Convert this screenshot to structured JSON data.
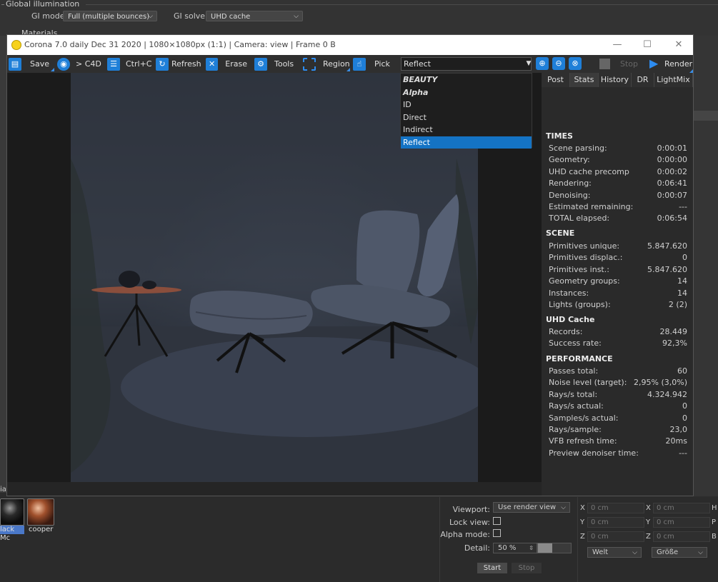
{
  "background": {
    "gi_section_title": "Global illumination",
    "gi_mode_label": "GI mode",
    "gi_mode_value": "Full (multiple bounces)",
    "gi_solver_label": "GI solver",
    "gi_solver_value": "UHD cache",
    "materials_title": "Materials",
    "media_label": "ia"
  },
  "materials": [
    {
      "label": "lack Mc"
    },
    {
      "label": "cooper"
    }
  ],
  "viewport_panel": {
    "viewport_label": "Viewport:",
    "viewport_value": "Use render view",
    "lock_view_label": "Lock view:",
    "alpha_mode_label": "Alpha mode:",
    "detail_label": "Detail:",
    "detail_value": "50 %",
    "start_label": "Start",
    "stop_label": "Stop"
  },
  "coords": {
    "rows": [
      {
        "a1": "X",
        "v1": "0 cm",
        "a2": "X",
        "v2": "0 cm",
        "a3": "H"
      },
      {
        "a1": "Y",
        "v1": "0 cm",
        "a2": "Y",
        "v2": "0 cm",
        "a3": "P"
      },
      {
        "a1": "Z",
        "v1": "0 cm",
        "a2": "Z",
        "v2": "0 cm",
        "a3": "B"
      }
    ],
    "space_value": "Welt",
    "size_value": "Größe"
  },
  "window": {
    "title": "Corona 7.0 daily Dec 31 2020 | 1080×1080px (1:1) | Camera: view | Frame 0 B",
    "minimize": "—",
    "maximize": "☐",
    "close": "✕"
  },
  "toolbar": {
    "save": "Save",
    "to_c4d": "> C4D",
    "copy": "Ctrl+C",
    "refresh": "Refresh",
    "erase": "Erase",
    "tools": "Tools",
    "region": "Region",
    "pick": "Pick",
    "pass_selected": "Reflect",
    "stop": "Stop",
    "render": "Render"
  },
  "pass_dropdown": {
    "items": [
      "BEAUTY",
      "Alpha",
      "ID",
      "Direct",
      "Indirect",
      "Reflect"
    ],
    "selected": "Reflect"
  },
  "panel_tabs": [
    "Post",
    "Stats",
    "History",
    "DR",
    "LightMix"
  ],
  "active_tab": "Stats",
  "stats": {
    "times": {
      "title": "TIMES",
      "rows": [
        {
          "k": "Scene parsing:",
          "v": "0:00:01"
        },
        {
          "k": "Geometry:",
          "v": "0:00:00"
        },
        {
          "k": "UHD cache precomp",
          "v": "0:00:02"
        },
        {
          "k": "Rendering:",
          "v": "0:06:41"
        },
        {
          "k": "Denoising:",
          "v": "0:00:07"
        },
        {
          "k": "Estimated remaining:",
          "v": "---"
        },
        {
          "k": "TOTAL elapsed:",
          "v": "0:06:54"
        }
      ]
    },
    "scene": {
      "title": "SCENE",
      "rows": [
        {
          "k": "Primitives unique:",
          "v": "5.847.620"
        },
        {
          "k": "Primitives displac.:",
          "v": "0"
        },
        {
          "k": "Primitives inst.:",
          "v": "5.847.620"
        },
        {
          "k": "Geometry groups:",
          "v": "14"
        },
        {
          "k": "Instances:",
          "v": "14"
        },
        {
          "k": "Lights (groups):",
          "v": "2 (2)"
        }
      ]
    },
    "uhd": {
      "title": "UHD Cache",
      "rows": [
        {
          "k": "Records:",
          "v": "28.449"
        },
        {
          "k": "Success rate:",
          "v": "92,3%"
        }
      ]
    },
    "performance": {
      "title": "PERFORMANCE",
      "rows": [
        {
          "k": "Passes total:",
          "v": "60"
        },
        {
          "k": "Noise level (target):",
          "v": "2,95% (3,0%)"
        },
        {
          "k": "Rays/s total:",
          "v": "4.324.942"
        },
        {
          "k": "Rays/s actual:",
          "v": "0"
        },
        {
          "k": "Samples/s actual:",
          "v": "0"
        },
        {
          "k": "Rays/sample:",
          "v": "23,0"
        },
        {
          "k": "VFB refresh time:",
          "v": "20ms"
        },
        {
          "k": "Preview denoiser time:",
          "v": "---"
        }
      ]
    }
  }
}
